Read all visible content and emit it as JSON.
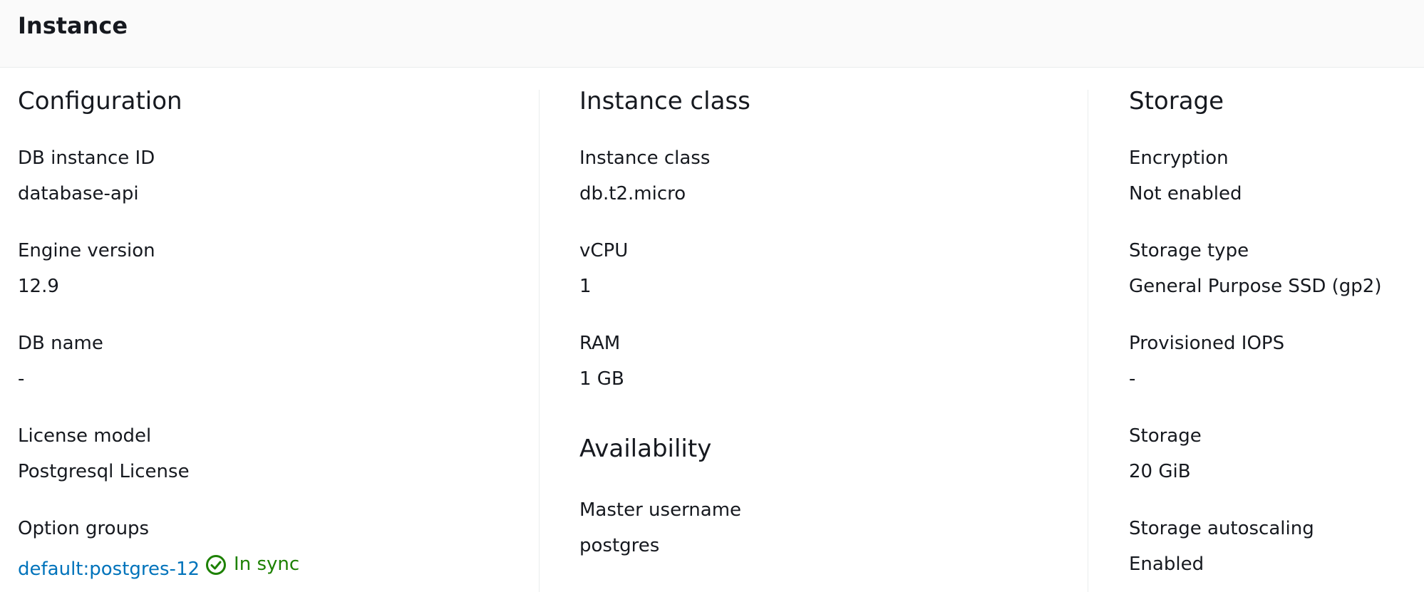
{
  "panel": {
    "title": "Instance"
  },
  "configuration": {
    "title": "Configuration",
    "fields": [
      {
        "label": "DB instance ID",
        "value": "database-api"
      },
      {
        "label": "Engine version",
        "value": "12.9"
      },
      {
        "label": "DB name",
        "value": "-"
      },
      {
        "label": "License model",
        "value": "Postgresql License"
      },
      {
        "label": "Option groups",
        "value": "default:postgres-12",
        "status": "In sync"
      }
    ]
  },
  "instance_class": {
    "title": "Instance class",
    "fields": [
      {
        "label": "Instance class",
        "value": "db.t2.micro"
      },
      {
        "label": "vCPU",
        "value": "1"
      },
      {
        "label": "RAM",
        "value": "1 GB"
      }
    ]
  },
  "availability": {
    "title": "Availability",
    "fields": [
      {
        "label": "Master username",
        "value": "postgres"
      }
    ]
  },
  "storage": {
    "title": "Storage",
    "fields": [
      {
        "label": "Encryption",
        "value": "Not enabled"
      },
      {
        "label": "Storage type",
        "value": "General Purpose SSD (gp2)"
      },
      {
        "label": "Provisioned IOPS",
        "value": "-"
      },
      {
        "label": "Storage",
        "value": "20 GiB"
      },
      {
        "label": "Storage autoscaling",
        "value": "Enabled"
      }
    ]
  },
  "colors": {
    "link": "#0073bb",
    "success": "#1d8102",
    "header_bg": "#fafafa",
    "divider": "#eaeded"
  },
  "icons": {
    "status": "check-circle-icon"
  }
}
